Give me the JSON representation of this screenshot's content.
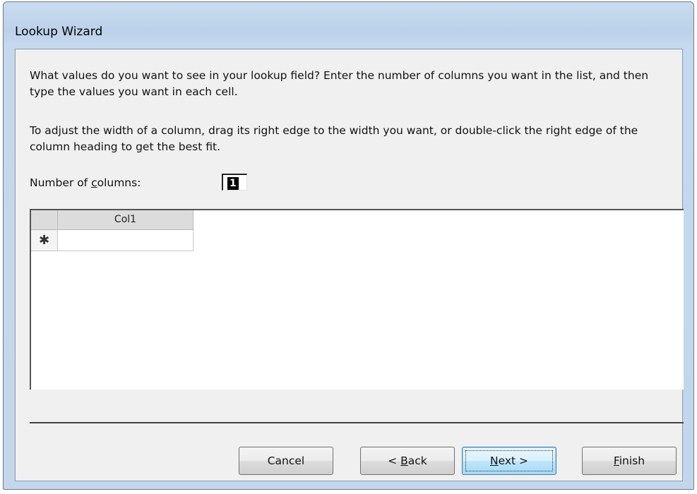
{
  "window": {
    "title": "Lookup Wizard"
  },
  "instructions": {
    "paragraph1": "What values do you want to see in your lookup field? Enter the number of columns you want in the list, and then type the values you want in each cell.",
    "paragraph2": "To adjust the width of a column, drag its right edge to the width you want, or double-click the right edge of the column heading to get the best fit."
  },
  "number_of_columns": {
    "label_prefix": "Number of ",
    "label_mnemonic": "c",
    "label_suffix": "olumns:",
    "value": "1"
  },
  "grid": {
    "columns": [
      "Col1"
    ],
    "new_row_marker": "✱",
    "rows": [
      [
        ""
      ]
    ]
  },
  "buttons": {
    "cancel": "Cancel",
    "back_prefix": "< ",
    "back_mnemonic": "B",
    "back_suffix": "ack",
    "next_mnemonic": "N",
    "next_suffix": "ext >",
    "finish_mnemonic": "F",
    "finish_suffix": "inish"
  }
}
